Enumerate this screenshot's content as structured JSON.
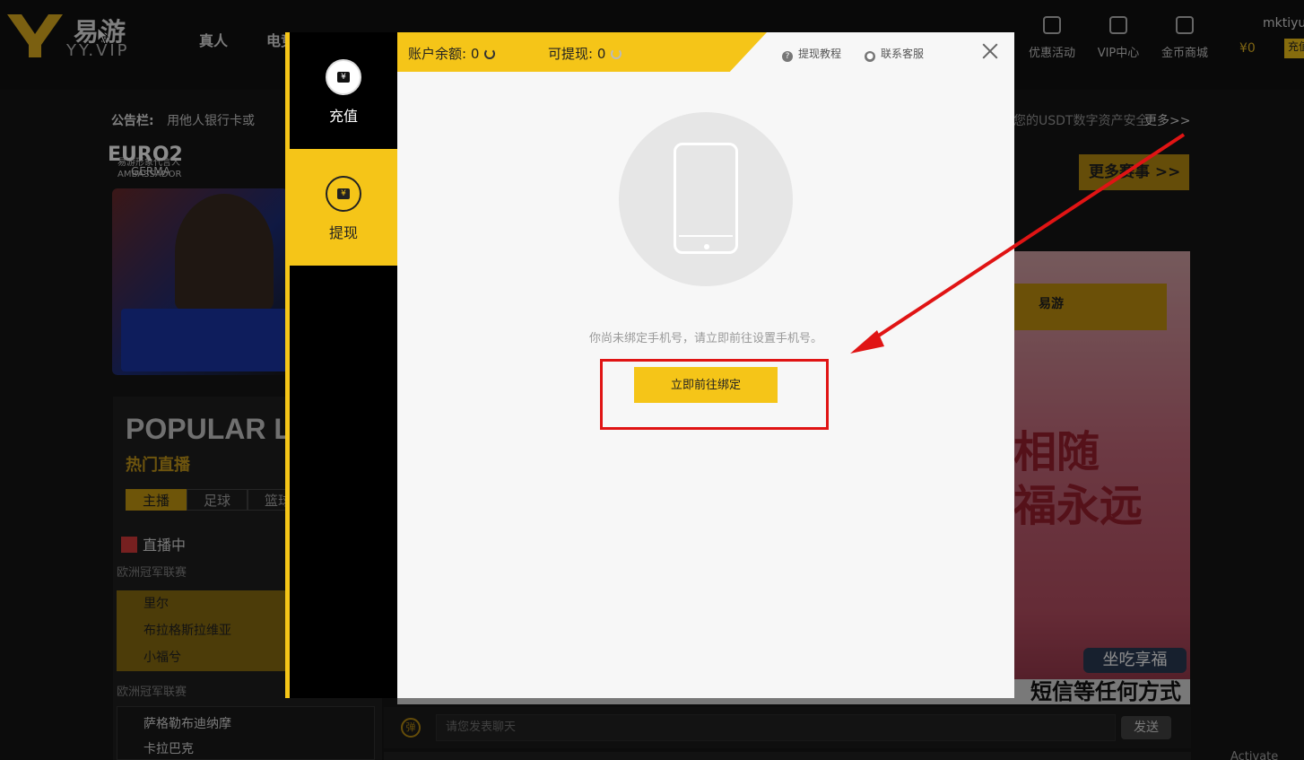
{
  "site": {
    "logo_cn": "易游",
    "logo_en": "YY.VIP",
    "nav_left": [
      "真人",
      "电竞"
    ],
    "nav_right": [
      "优惠活动",
      "VIP中心",
      "金币商城"
    ],
    "user_name": "mktiyu",
    "user_balance": "¥0",
    "user_btn": "充值",
    "notice_label": "公告栏:",
    "notice_text": "用他人银行卡或",
    "notice_tail": "您的USDT数字资产安全",
    "notice_more": "更多>>",
    "ambassador_title": "易游形象代言人",
    "ambassador_sub": "AMBASSADOR",
    "ambassador_brand": "易游",
    "euro_text": "EURO2",
    "euro_sub": "GERMA",
    "popular_title": "POPULAR LIV",
    "popular_sub": "热门直播",
    "live_tabs": [
      "主播",
      "足球",
      "篮球"
    ],
    "live_now": "直播中",
    "league_1": "欧洲冠军联赛",
    "teams_1": [
      "里尔",
      "布拉格斯拉维亚",
      "小福兮"
    ],
    "league_2": "欧洲冠军联赛",
    "teams_2": [
      "萨格勒布迪纳摩",
      "卡拉巴克"
    ],
    "more_matches": "更多赛事 >>",
    "banner_brand": "易游",
    "banner_big_1": "相随",
    "banner_big_2": "福永远",
    "banner_tag": "坐吃享福",
    "ticker": "短信等任何方式",
    "chat_icon": "弹",
    "chat_placeholder": "请您发表聊天",
    "chat_send": "发送",
    "activate": "Activate"
  },
  "modal": {
    "side_items": [
      {
        "label": "充值",
        "icon": "¥",
        "active": false
      },
      {
        "label": "提现",
        "icon": "¥",
        "active": true
      }
    ],
    "balance_label": "账户余额: 0",
    "withdrawable_label": "可提现: 0",
    "tutorial_link": "提现教程",
    "service_link": "联系客服",
    "bind_message": "你尚未绑定手机号，请立即前往设置手机号。",
    "bind_button": "立即前往绑定"
  },
  "colors": {
    "accent": "#f5c518",
    "annotation": "#e01414"
  }
}
